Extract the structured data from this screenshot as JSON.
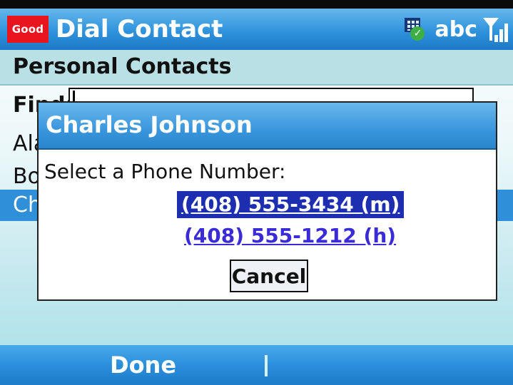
{
  "titlebar": {
    "logo_text": "Good",
    "title": "Dial Contact",
    "input_mode": "abc"
  },
  "subheader": {
    "text": "Personal Contacts"
  },
  "find": {
    "label": "Find:",
    "value": ""
  },
  "list": {
    "items": [
      "Ala",
      "Bo",
      "Ch"
    ],
    "selected_index": 2
  },
  "dialog": {
    "title": "Charles Johnson",
    "prompt": "Select a Phone Number:",
    "numbers": [
      "(408) 555-3434 (m)",
      "(408) 555-1212 (h)"
    ],
    "cancel_label": "Cancel"
  },
  "softkeys": {
    "left": "Done",
    "right": ""
  },
  "colors": {
    "title_blue": "#2f93dc",
    "logo_red": "#e8151e",
    "selected_number_bg": "#1d2fb0",
    "link_purple": "#3a2ad8"
  },
  "icons": [
    "keyboard-input-icon",
    "signal-strength-icon"
  ]
}
